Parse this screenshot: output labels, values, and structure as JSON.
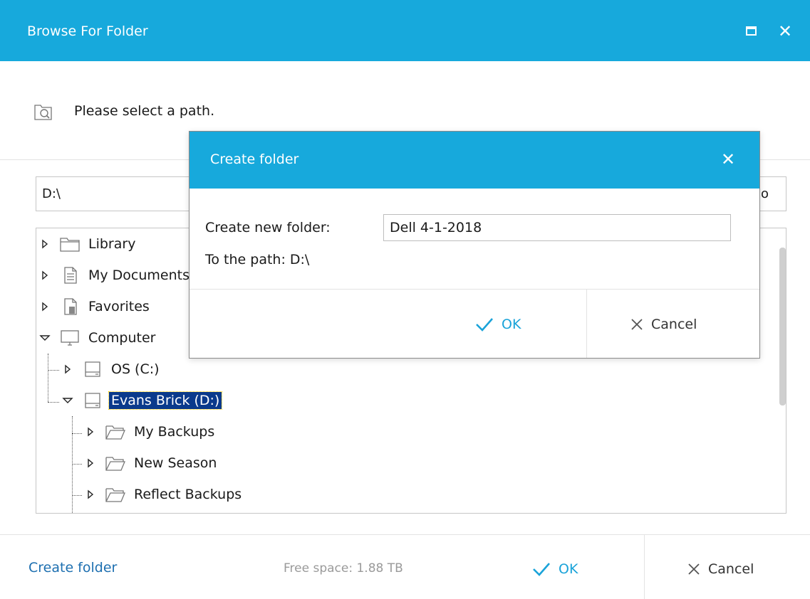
{
  "window": {
    "title": "Browse For Folder"
  },
  "prompt": {
    "text": "Please select a path."
  },
  "path_field": {
    "value": "D:\\",
    "trailing_fragment": "o"
  },
  "tree": {
    "items": [
      {
        "label": "Library",
        "icon": "folder-icon",
        "expander": "collapsed"
      },
      {
        "label": "My Documents",
        "icon": "document-icon",
        "expander": "collapsed"
      },
      {
        "label": "Favorites",
        "icon": "favorites-icon",
        "expander": "collapsed"
      },
      {
        "label": "Computer",
        "icon": "computer-icon",
        "expander": "expanded"
      },
      {
        "label": "OS (C:)",
        "icon": "drive-icon",
        "expander": "collapsed"
      },
      {
        "label": "Evans Brick (D:)",
        "icon": "drive-icon",
        "expander": "expanded",
        "selected": true
      },
      {
        "label": "My Backups",
        "icon": "folder-open-icon",
        "expander": "collapsed"
      },
      {
        "label": "New Season",
        "icon": "folder-open-icon",
        "expander": "collapsed"
      },
      {
        "label": "Reflect Backups",
        "icon": "folder-open-icon",
        "expander": "collapsed"
      }
    ]
  },
  "footer": {
    "create_folder": "Create folder",
    "free_space": "Free space: 1.88 TB",
    "ok": "OK",
    "cancel": "Cancel"
  },
  "modal": {
    "title": "Create folder",
    "label": "Create new folder:",
    "input_value": "Dell 4-1-2018",
    "path_text": "To the path: D:\\",
    "ok": "OK",
    "cancel": "Cancel"
  },
  "colors": {
    "titlebar": "#17a9dc",
    "accent": "#1aa3d9",
    "link": "#1d6fb0",
    "selection": "#0a3a8c"
  }
}
